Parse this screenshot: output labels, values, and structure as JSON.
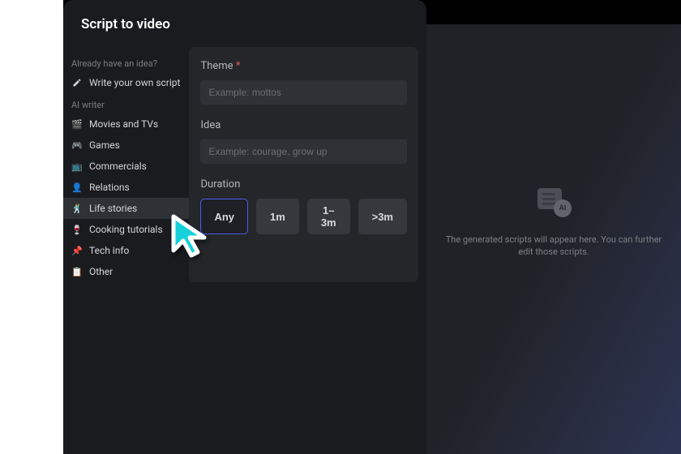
{
  "pageTitle": "Script to video",
  "sidebar": {
    "section1Label": "Already have an idea?",
    "writeOwn": "Write your own script",
    "section2Label": "AI writer",
    "items": [
      {
        "id": "movies",
        "label": "Movies and TVs",
        "icon": "🎬"
      },
      {
        "id": "games",
        "label": "Games",
        "icon": "🎮"
      },
      {
        "id": "commercials",
        "label": "Commercials",
        "icon": "📺"
      },
      {
        "id": "relations",
        "label": "Relations",
        "icon": "👤"
      },
      {
        "id": "life",
        "label": "Life stories",
        "icon": "🕺"
      },
      {
        "id": "cooking",
        "label": "Cooking tutorials",
        "icon": "🍷"
      },
      {
        "id": "tech",
        "label": "Tech info",
        "icon": "📌"
      },
      {
        "id": "other",
        "label": "Other",
        "icon": "📋"
      }
    ]
  },
  "form": {
    "themeLabel": "Theme",
    "themePlaceholder": "Example: mottos",
    "ideaLabel": "Idea",
    "ideaPlaceholder": "Example: courage, grow up",
    "durationLabel": "Duration",
    "durationOptions": [
      "Any",
      "1m",
      "1–3m",
      ">3m"
    ],
    "durationSelected": 0
  },
  "placeholder": {
    "iconText": "AI",
    "text": "The generated scripts will appear here. You can further edit those scripts."
  },
  "colors": {
    "accent": "#16d0da",
    "primaryBorder": "#4a5df0"
  }
}
